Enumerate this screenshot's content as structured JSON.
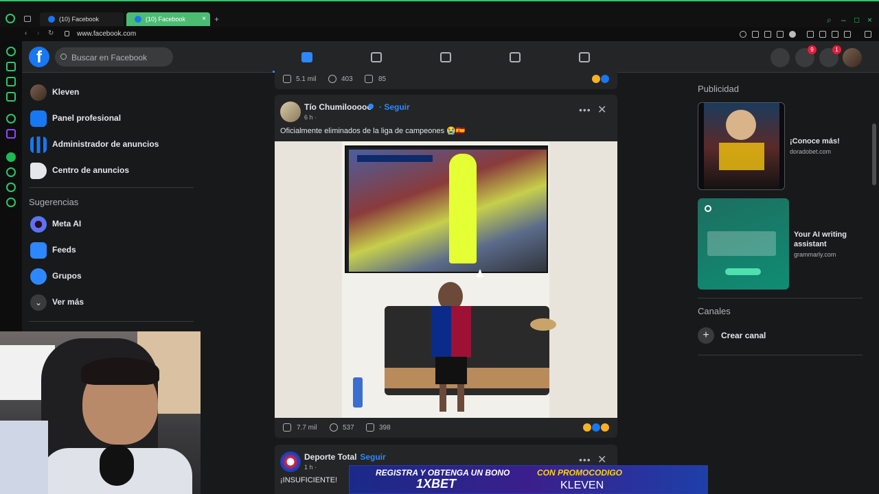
{
  "browser": {
    "tabs": [
      {
        "label": "(10) Facebook",
        "active": false
      },
      {
        "label": "(10) Facebook",
        "active": true
      }
    ],
    "url": "www.facebook.com",
    "accent": "#2dc86a"
  },
  "header": {
    "logo": "f",
    "search_placeholder": "Buscar en Facebook",
    "nav_icons": [
      "home-icon",
      "flag-icon",
      "marketplace-icon",
      "megaphone-icon",
      "video-icon"
    ],
    "messenger_badge": "9",
    "notifications_badge": "1"
  },
  "sidebar": {
    "items": [
      {
        "label": "Kleven",
        "icon": "profile-avatar"
      },
      {
        "label": "Panel profesional",
        "icon": "dashboard-icon"
      },
      {
        "label": "Administrador de anuncios",
        "icon": "bar-chart-icon"
      },
      {
        "label": "Centro de anuncios",
        "icon": "megaphone-icon"
      }
    ],
    "suggestions_title": "Sugerencias",
    "suggestions": [
      {
        "label": "Meta AI",
        "icon": "meta-ai-icon"
      },
      {
        "label": "Feeds",
        "icon": "feeds-icon"
      },
      {
        "label": "Grupos",
        "icon": "groups-icon"
      },
      {
        "label": "Ver más",
        "icon": "chevron-down-icon"
      }
    ]
  },
  "feed": {
    "prev_post": {
      "likes": "5.1 mil",
      "comments": "403",
      "shares": "85"
    },
    "post1": {
      "author": "Tío Chumilooooo",
      "follow": "Seguir",
      "time": "6 h ·",
      "caption": "Oficialmente eliminados de la liga de campeones 😭🇪🇸",
      "likes": "7.7 mil",
      "comments": "537",
      "shares": "398"
    },
    "post2": {
      "author": "Deporte Total",
      "follow": "Seguir",
      "time": "1 h ·",
      "caption": "¡INSUFICIENTE!"
    }
  },
  "right": {
    "ads_title": "Publicidad",
    "ads": [
      {
        "title": "¡Conoce más!",
        "domain": "doradobet.com"
      },
      {
        "title": "Your AI writing assistant",
        "domain": "grammarly.com"
      }
    ],
    "channels_title": "Canales",
    "create_channel": "Crear canal"
  },
  "banner": {
    "line1": "REGISTRA Y OBTENGA UN BONO",
    "brand": "1XBET",
    "promo_label": "CON PROMOCODIGO",
    "promo_code": "KLEVEN"
  }
}
